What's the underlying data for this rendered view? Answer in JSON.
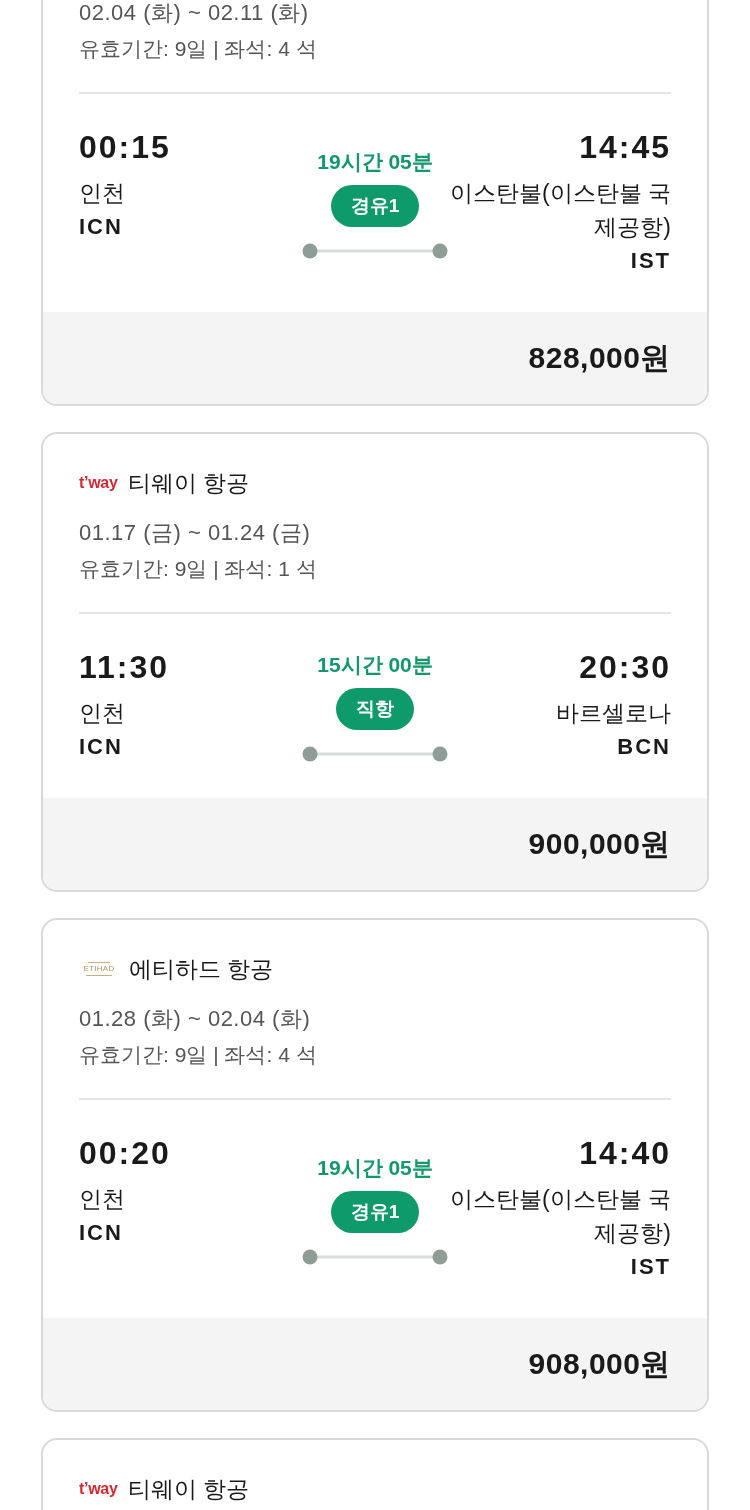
{
  "flights": [
    {
      "dates": "02.04 (화) ~ 02.11 (화)",
      "validity": "유효기간: 9일 | 좌석: 4 석",
      "departure": {
        "time": "00:15",
        "city": "인천",
        "code": "ICN"
      },
      "duration": "19시간 05분",
      "stops": "경유1",
      "arrival": {
        "time": "14:45",
        "city": "이스탄불(이스탄불 국제공항)",
        "code": "IST"
      },
      "price": "828,000원"
    },
    {
      "airline": {
        "logo": {
          "kind": "plain",
          "text": "t’way"
        },
        "name": "티웨이 항공"
      },
      "dates": "01.17 (금) ~ 01.24 (금)",
      "validity": "유효기간: 9일 | 좌석: 1 석",
      "departure": {
        "time": "11:30",
        "city": "인천",
        "code": "ICN"
      },
      "duration": "15시간 00분",
      "stops": "직항",
      "arrival": {
        "time": "20:30",
        "city": "바르셀로나",
        "code": "BCN"
      },
      "price": "900,000원"
    },
    {
      "airline": {
        "logo": {
          "kind": "stacked",
          "text": "ETIHAD"
        },
        "name": "에티하드 항공"
      },
      "dates": "01.28 (화) ~ 02.04 (화)",
      "validity": "유효기간: 9일 | 좌석: 4 석",
      "departure": {
        "time": "00:20",
        "city": "인천",
        "code": "ICN"
      },
      "duration": "19시간 05분",
      "stops": "경유1",
      "arrival": {
        "time": "14:40",
        "city": "이스탄불(이스탄불 국제공항)",
        "code": "IST"
      },
      "price": "908,000원"
    },
    {
      "airline": {
        "logo": {
          "kind": "plain",
          "text": "t’way"
        },
        "name": "티웨이 항공"
      }
    }
  ]
}
